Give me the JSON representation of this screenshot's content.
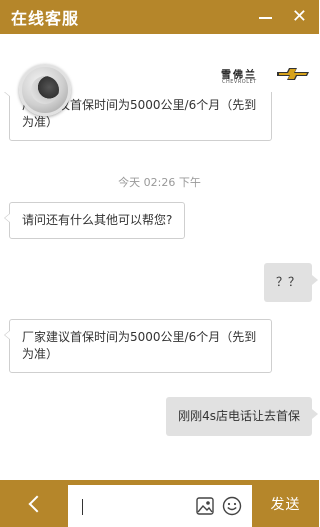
{
  "window": {
    "title": "在线客服",
    "minimize_icon": "minimize-icon",
    "close_icon": "close-icon",
    "close_glyph": "✕"
  },
  "brand": {
    "name": "雪佛兰",
    "sub": "CHEVROLET",
    "logo_color": "#d6a21c"
  },
  "messages": [
    {
      "side": "left",
      "text_lines": [
        "厂家建议首保时间为5000公里/6个月（先到",
        "为准）"
      ]
    },
    {
      "side": "timestamp",
      "text": "今天 02:26 下午"
    },
    {
      "side": "left",
      "text_lines": [
        "请问还有什么其他可以帮您?"
      ]
    },
    {
      "side": "right",
      "text_lines": [
        "？？"
      ]
    },
    {
      "side": "left",
      "text_lines": [
        "厂家建议首保时间为5000公里/6个月（先到",
        "为准）"
      ]
    },
    {
      "side": "right",
      "text_lines": [
        "刚刚4s店电话让去首保"
      ]
    }
  ],
  "input": {
    "value": "",
    "back_icon": "chevron-left-icon",
    "image_icon": "image-icon",
    "emoji_icon": "emoji-icon",
    "send_label": "发送"
  },
  "colors": {
    "accent": "#b5862a",
    "bubble_right": "#e1e1e1",
    "bubble_left_border": "#cfcfcf",
    "timestamp": "#999999"
  }
}
